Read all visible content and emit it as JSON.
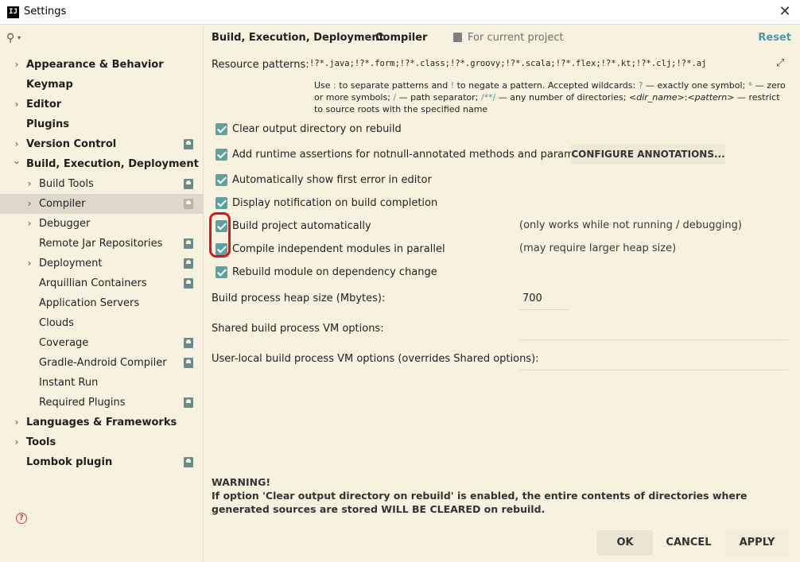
{
  "window": {
    "title": "Settings",
    "app_icon": "IJ",
    "close_icon": "close-icon"
  },
  "sidebar": {
    "search_icon": "search-icon",
    "items": [
      {
        "label": "Appearance & Behavior",
        "bold": true,
        "arrow": "chevron-right-icon"
      },
      {
        "label": "Keymap",
        "bold": true
      },
      {
        "label": "Editor",
        "bold": true,
        "arrow": "chevron-right-icon"
      },
      {
        "label": "Plugins",
        "bold": true
      },
      {
        "label": "Version Control",
        "bold": true,
        "arrow": "chevron-right-icon",
        "project_icon": true
      },
      {
        "label": "Build, Execution, Deployment",
        "bold": true,
        "arrow": "chevron-down-icon"
      },
      {
        "label": "Build Tools",
        "arrow": "chevron-right-icon",
        "project_icon": true
      },
      {
        "label": "Compiler",
        "arrow": "chevron-right-icon",
        "project_icon": true,
        "selected": true
      },
      {
        "label": "Debugger",
        "arrow": "chevron-right-icon"
      },
      {
        "label": "Remote Jar Repositories",
        "project_icon": true
      },
      {
        "label": "Deployment",
        "arrow": "chevron-right-icon",
        "project_icon": true
      },
      {
        "label": "Arquillian Containers",
        "project_icon": true
      },
      {
        "label": "Application Servers"
      },
      {
        "label": "Clouds"
      },
      {
        "label": "Coverage",
        "project_icon": true
      },
      {
        "label": "Gradle-Android Compiler",
        "project_icon": true
      },
      {
        "label": "Instant Run"
      },
      {
        "label": "Required Plugins",
        "project_icon": true
      },
      {
        "label": "Languages & Frameworks",
        "bold": true,
        "arrow": "chevron-right-icon"
      },
      {
        "label": "Tools",
        "bold": true,
        "arrow": "chevron-right-icon"
      },
      {
        "label": "Lombok plugin",
        "bold": true,
        "project_icon": true
      }
    ]
  },
  "header": {
    "breadcrumb_parent": "Build, Execution, Deployment",
    "breadcrumb_separator": "›",
    "breadcrumb_current": "Compiler",
    "for_project": "For current project",
    "reset": "Reset"
  },
  "resources": {
    "label": "Resource patterns:",
    "value": "!?*.java;!?*.form;!?*.class;!?*.groovy;!?*.scala;!?*.flex;!?*.kt;!?*.clj;!?*.aj",
    "expand_icon": "expand-icon"
  },
  "hint": {
    "p1": "Use ",
    "semicolon": ";",
    "p2": " to separate patterns and ",
    "bang": "!",
    "p3": " to negate a pattern. Accepted wildcards: ",
    "q": "?",
    "p4": " — exactly one symbol; ",
    "star": "*",
    "p5": " — zero or more symbols; ",
    "slash": "/",
    "p6": " — path separator; ",
    "dstar": "/**/",
    "p7": " — any number of directories; ",
    "dir": "<dir_name>",
    "colon": ":",
    "pattern": "<pattern>",
    "p8": " — restrict to source roots with the specified name"
  },
  "options": [
    {
      "label": "Clear output directory on rebuild",
      "checked": true
    },
    {
      "label": "Add runtime assertions for notnull-annotated methods and parameters",
      "checked": true
    },
    {
      "label": "Automatically show first error in editor",
      "checked": true
    },
    {
      "label": "Display notification on build completion",
      "checked": true
    },
    {
      "label": "Build project automatically",
      "checked": true,
      "note": "(only works while not running / debugging)"
    },
    {
      "label": "Compile independent modules in parallel",
      "checked": true,
      "note": "(may require larger heap size)"
    },
    {
      "label": "Rebuild module on dependency change",
      "checked": true
    }
  ],
  "configure_annotations": "CONFIGURE ANNOTATIONS...",
  "fields": {
    "heap_label": "Build process heap size (Mbytes):",
    "heap_value": "700",
    "shared_label": "Shared build process VM options:",
    "shared_value": "",
    "user_label": "User-local build process VM options (overrides Shared options):",
    "user_value": ""
  },
  "warning": {
    "title": "WARNING!",
    "text": "If option 'Clear output directory on rebuild' is enabled, the entire contents of directories where generated sources are stored WILL BE CLEARED on rebuild."
  },
  "footer": {
    "help_icon": "help-icon",
    "ok": "OK",
    "cancel": "CANCEL",
    "apply": "APPLY"
  },
  "colors": {
    "accent": "#5aa1a3",
    "link": "#4a9aa8",
    "annotation": "#e0131b",
    "background": "#f7f1e0"
  }
}
